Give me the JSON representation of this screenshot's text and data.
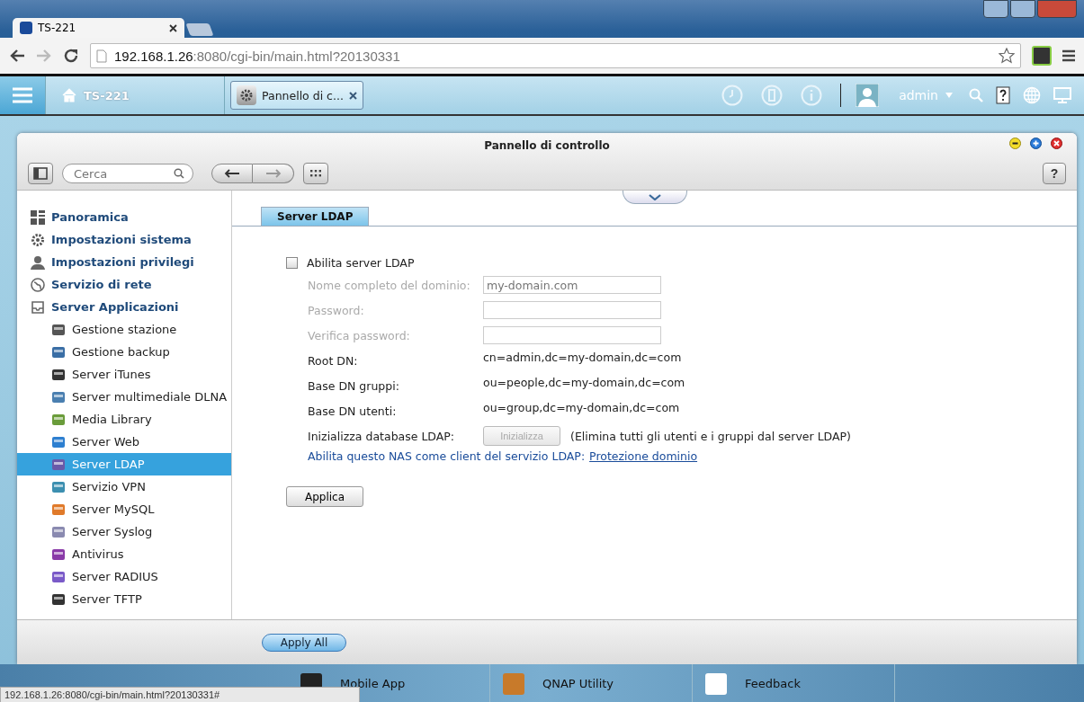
{
  "browser": {
    "tab_title": "TS-221",
    "url_host": "192.168.1.26",
    "url_rest": ":8080/cgi-bin/main.html?20130331",
    "status_url": "192.168.1.26:8080/cgi-bin/main.html?20130331#"
  },
  "app_bar": {
    "home_label": "TS-221",
    "open_app": "Pannello di c...",
    "user": "admin"
  },
  "window": {
    "title": "Pannello di controllo",
    "help_label": "?",
    "search": {
      "placeholder": "Cerca"
    }
  },
  "sidebar": {
    "items": [
      {
        "label": "Panoramica",
        "selected": false
      },
      {
        "label": "Impostazioni sistema",
        "selected": false
      },
      {
        "label": "Impostazioni privilegi",
        "selected": false
      },
      {
        "label": "Servizio di rete",
        "selected": false
      },
      {
        "label": "Server Applicazioni",
        "selected": false,
        "children": [
          {
            "label": "Gestione stazione",
            "selected": false
          },
          {
            "label": "Gestione backup",
            "selected": false
          },
          {
            "label": "Server iTunes",
            "selected": false
          },
          {
            "label": "Server multimediale DLNA",
            "selected": false
          },
          {
            "label": "Media Library",
            "selected": false
          },
          {
            "label": "Server Web",
            "selected": false
          },
          {
            "label": "Server LDAP",
            "selected": true
          },
          {
            "label": "Servizio VPN",
            "selected": false
          },
          {
            "label": "Server MySQL",
            "selected": false
          },
          {
            "label": "Server Syslog",
            "selected": false
          },
          {
            "label": "Antivirus",
            "selected": false
          },
          {
            "label": "Server RADIUS",
            "selected": false
          },
          {
            "label": "Server TFTP",
            "selected": false
          }
        ]
      }
    ]
  },
  "tabs": [
    {
      "label": "Server LDAP",
      "selected": true
    }
  ],
  "enable": {
    "label": "Abilita server LDAP",
    "checked": false
  },
  "fields": [
    {
      "kind": "input",
      "label": "Nome completo del dominio:",
      "placeholder": "my-domain.com",
      "disabled": true
    },
    {
      "kind": "input",
      "label": "Password:",
      "disabled": true
    },
    {
      "kind": "input",
      "label": "Verifica password:",
      "disabled": true
    },
    {
      "kind": "text",
      "label": "Root DN:",
      "value": "cn=admin,dc=my-domain,dc=com",
      "disabled": false
    },
    {
      "kind": "text",
      "label": "Base DN gruppi:",
      "value": "ou=people,dc=my-domain,dc=com",
      "disabled": false
    },
    {
      "kind": "text",
      "label": "Base DN utenti:",
      "value": "ou=group,dc=my-domain,dc=com",
      "disabled": false
    },
    {
      "kind": "button",
      "label": "Inizializza database LDAP:",
      "value": "Inizializza",
      "note": "(Elimina tutti gli utenti e i gruppi dal server LDAP)",
      "disabled": false,
      "button_disabled": true
    }
  ],
  "client_line": {
    "text": "Abilita questo NAS come client del servizio LDAP:",
    "link": "Protezione dominio"
  },
  "apply_button": "Applica",
  "footer_button": "Apply All",
  "dock": [
    "Mobile App",
    "QNAP Utility",
    "Feedback"
  ]
}
